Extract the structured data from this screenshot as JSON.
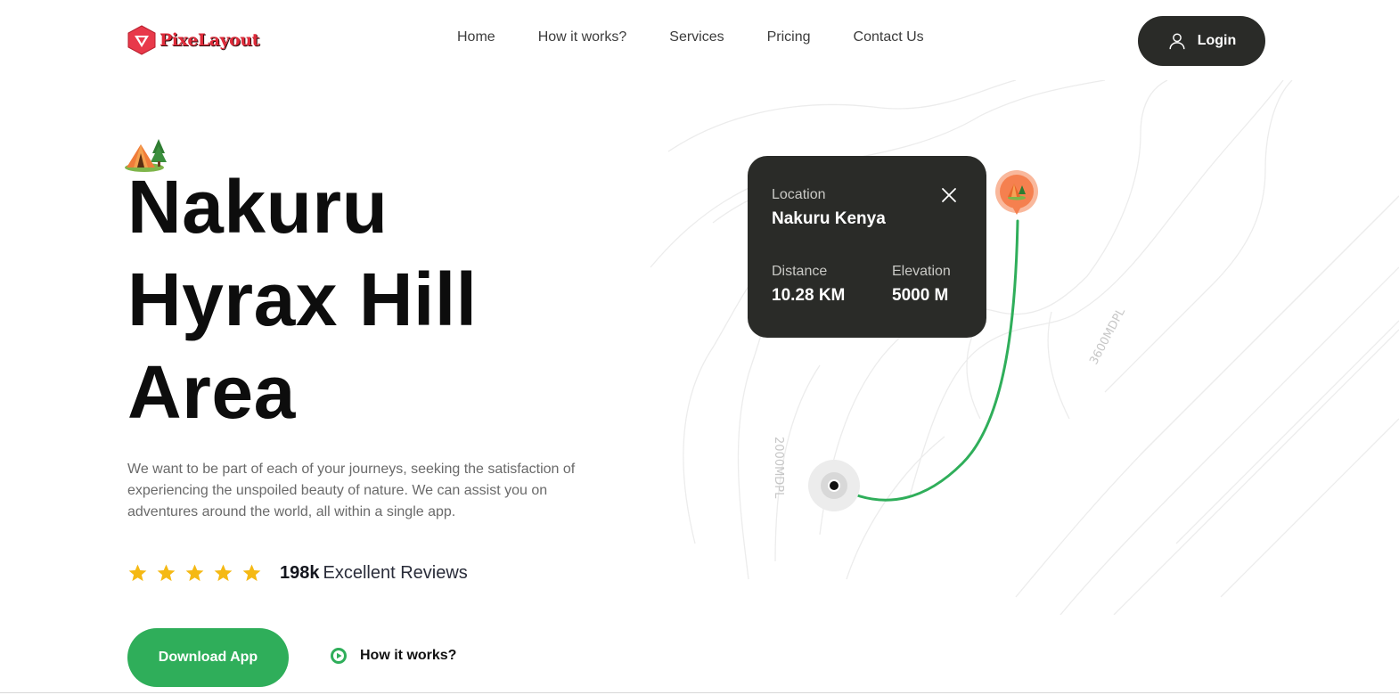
{
  "header": {
    "logo_text": "PixeLayout",
    "nav": [
      {
        "label": "Home"
      },
      {
        "label": "How it works?"
      },
      {
        "label": "Services"
      },
      {
        "label": "Pricing"
      },
      {
        "label": "Contact Us"
      }
    ],
    "login_label": "Login"
  },
  "hero": {
    "title_lines": [
      "Nakuru",
      "Hyrax Hill",
      "Area"
    ],
    "description": "We want to be part of each of your journeys, seeking the satisfaction of experiencing the unspoiled beauty of nature. We can assist you on adventures around the world, all within a single app.",
    "rating": {
      "stars": 5,
      "count": "198k",
      "label": "Excellent Reviews"
    },
    "download_label": "Download App",
    "how_label": "How it works?"
  },
  "map": {
    "card": {
      "location_label": "Location",
      "location_value": "Nakuru Kenya",
      "distance_label": "Distance",
      "distance_value": "10.28 KM",
      "elevation_label": "Elevation",
      "elevation_value": "5000 M"
    },
    "contour_labels": [
      "3600MDPL",
      "2000MDPL"
    ]
  },
  "colors": {
    "accent_green": "#2fae5a",
    "dark": "#2a2b28",
    "star": "#f5b914",
    "pin_orange": "#f5804f",
    "logo_red": "#e02b3a"
  }
}
